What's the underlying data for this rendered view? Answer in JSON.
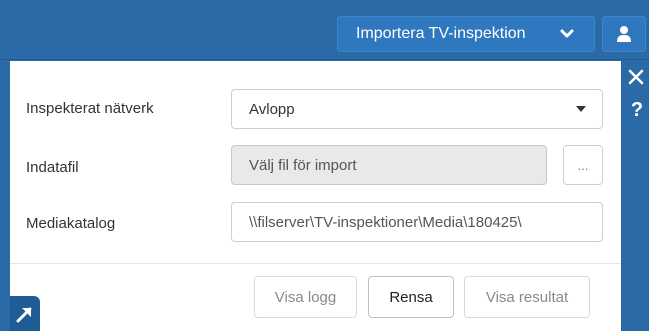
{
  "header": {
    "import_label": "Importera TV-inspektion",
    "import_icon": "chevron-down-icon",
    "user_icon": "user-icon"
  },
  "side": {
    "close_icon": "close-icon",
    "help_label": "?"
  },
  "form": {
    "network_label": "Inspekterat nätverk",
    "network_value": "Avlopp",
    "infile_label": "Indatafil",
    "infile_placeholder": "Välj fil för import",
    "browse_label": "...",
    "media_label": "Mediakatalog",
    "media_value": "\\\\filserver\\TV-inspektioner\\Media\\180425\\"
  },
  "actions": {
    "log_label": "Visa logg",
    "clear_label": "Rensa",
    "results_label": "Visa resultat"
  },
  "colors": {
    "accent": "#2a6aa6",
    "button_blue": "#2f78bf"
  }
}
